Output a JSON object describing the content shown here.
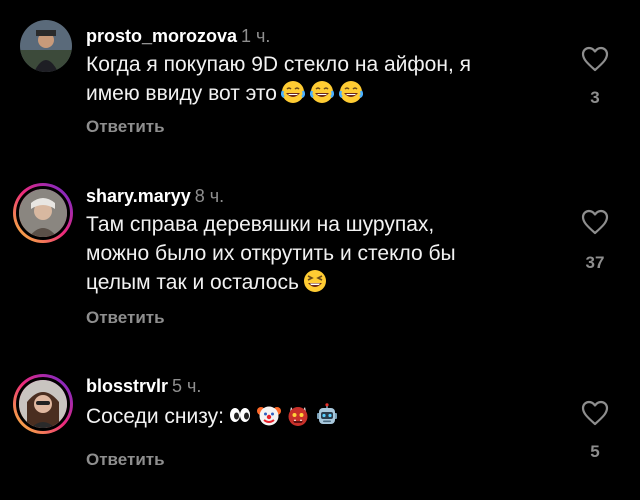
{
  "comments": [
    {
      "username": "prosto_morozova",
      "time": "1 ч.",
      "text_lines": [
        "Когда я покупаю 9D стекло на айфон, я",
        "имею ввиду вот это"
      ],
      "emojis": [
        "tears-of-joy-emoji",
        "tears-of-joy-emoji",
        "tears-of-joy-emoji"
      ],
      "reply_label": "Ответить",
      "like_count": "3",
      "has_story_ring": false
    },
    {
      "username": "shary.maryy",
      "time": "8 ч.",
      "text_lines": [
        "Там справа деревяшки на шурупах,",
        "можно было их открутить и стекло бы",
        "целым так и осталось"
      ],
      "emojis": [
        "laughing-squint-emoji"
      ],
      "reply_label": "Ответить",
      "like_count": "37",
      "has_story_ring": true
    },
    {
      "username": "blosstrvlr",
      "time": "5 ч.",
      "text_lines": [
        "Соседи снизу:"
      ],
      "emojis": [
        "eyes-emoji",
        "clown-face-emoji",
        "ogre-emoji",
        "robot-emoji"
      ],
      "reply_label": "Ответить",
      "like_count": "5",
      "has_story_ring": true
    }
  ],
  "colors": {
    "background": "#000000",
    "secondary_text": "#8e8e8e",
    "primary_text": "#ffffff"
  }
}
